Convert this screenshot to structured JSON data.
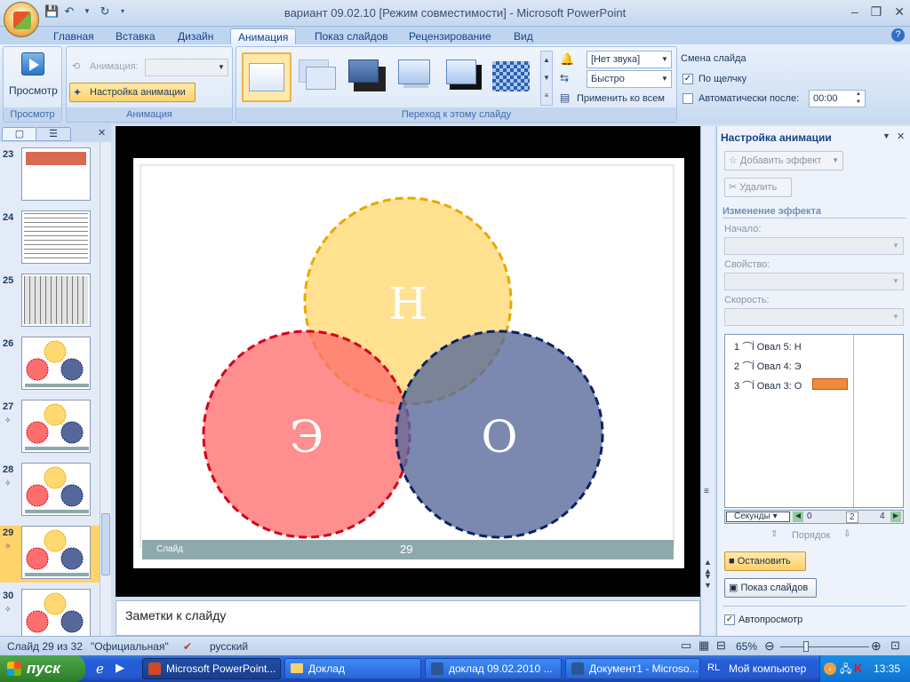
{
  "window": {
    "title": "вариант 09.02.10 [Режим совместимости] - Microsoft PowerPoint",
    "controls": [
      "–",
      "❐",
      "✕"
    ]
  },
  "ribbon": {
    "tabs": [
      "Главная",
      "Вставка",
      "Дизайн",
      "Анимация",
      "Показ слайдов",
      "Рецензирование",
      "Вид"
    ],
    "active_tab": "Анимация",
    "preview": {
      "label": "Просмотр",
      "group": "Просмотр"
    },
    "animation": {
      "anim_label": "Анимация:",
      "custom_label": "Настройка анимации",
      "group": "Анимация"
    },
    "transition": {
      "group": "Переход к этому слайду",
      "sound": "[Нет звука]",
      "speed": "Быстро",
      "apply_all": "Применить ко всем"
    },
    "slide_change": {
      "title": "Смена слайда",
      "on_click": "По щелчку",
      "on_click_checked": true,
      "auto_after": "Автоматически после:",
      "auto_after_checked": false,
      "time": "00:00"
    }
  },
  "slides_panel": {
    "items": [
      {
        "num": "23"
      },
      {
        "num": "24"
      },
      {
        "num": "25"
      },
      {
        "num": "26"
      },
      {
        "num": "27"
      },
      {
        "num": "28"
      },
      {
        "num": "29",
        "selected": true
      },
      {
        "num": "30"
      }
    ]
  },
  "slide": {
    "circles": [
      {
        "letter": "Н",
        "fill": "#ffd870",
        "stroke": "#e6a800"
      },
      {
        "letter": "Э",
        "fill": "#ff6e6e",
        "stroke": "#d4001a"
      },
      {
        "letter": "О",
        "fill": "#56689a",
        "stroke": "#0e2260"
      }
    ],
    "footer_left": "Слайд",
    "footer_num": "29"
  },
  "notes": {
    "placeholder": "Заметки к слайду"
  },
  "task_pane": {
    "title": "Настройка анимации",
    "add_effect": "Добавить эффект",
    "remove": "Удалить",
    "change_effect": "Изменение эффекта",
    "start_label": "Начало:",
    "property_label": "Свойство:",
    "speed_label": "Скорость:",
    "effects": [
      {
        "order": "1",
        "name": "Овал 5: Н"
      },
      {
        "order": "2",
        "name": "Овал 4: Э"
      },
      {
        "order": "3",
        "name": "Овал 3: О"
      }
    ],
    "timeline": {
      "unit": "Секунды",
      "ticks": [
        "0",
        "2",
        "4"
      ]
    },
    "reorder": "Порядок",
    "stop": "Остановить",
    "slideshow": "Показ слайдов",
    "autopreview": "Автопросмотр",
    "autopreview_checked": true
  },
  "status": {
    "slide_info": "Слайд 29 из 32",
    "theme": "\"Официальная\"",
    "language": "русский",
    "zoom": "65%"
  },
  "taskbar": {
    "start": "пуск",
    "tasks": [
      "Microsoft PowerPoint...",
      "Доклад",
      "доклад 09.02.2010 ...",
      "Документ1 - Microso..."
    ],
    "tray_label": "Мой компьютер",
    "tray_prefix": "RL",
    "clock": "13:35"
  },
  "colors": {
    "accent": "#15428b",
    "selection": "#ffd36b",
    "effect_bar": "#f28a3b"
  }
}
